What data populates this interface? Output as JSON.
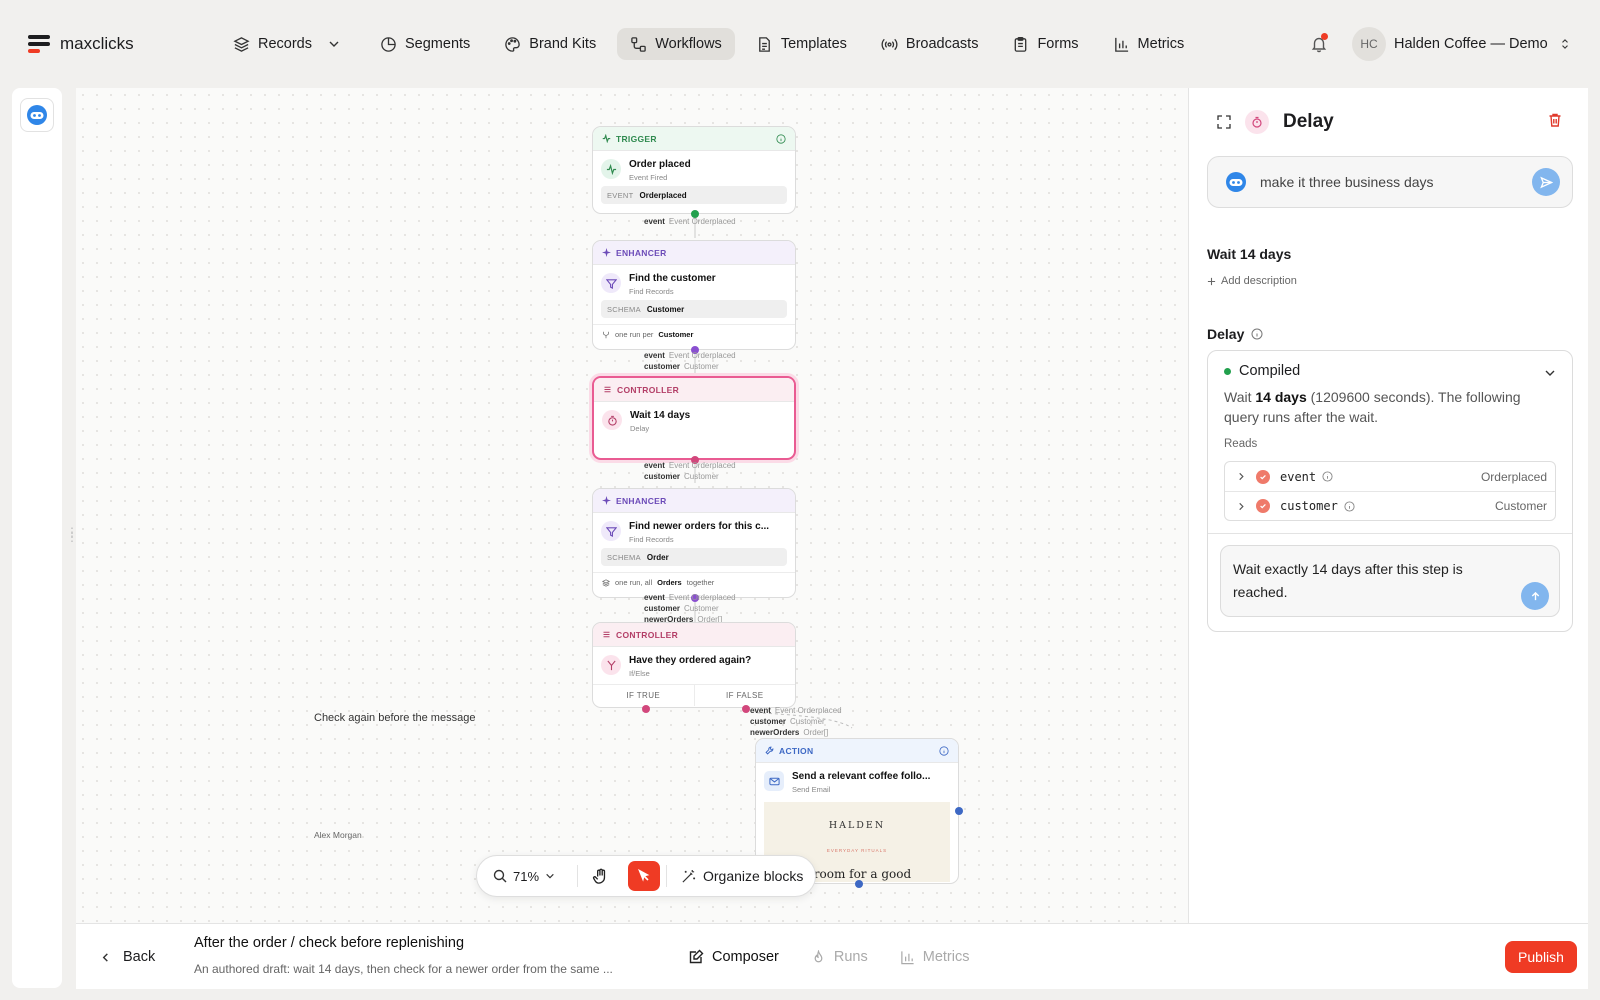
{
  "app": {
    "name": "maxclicks"
  },
  "nav": [
    {
      "label": "Records",
      "icon": "layers-icon",
      "has_dropdown": true
    },
    {
      "label": "Segments",
      "icon": "pie-icon"
    },
    {
      "label": "Brand Kits",
      "icon": "palette-icon"
    },
    {
      "label": "Workflows",
      "icon": "workflow-icon",
      "active": true
    },
    {
      "label": "Templates",
      "icon": "document-icon"
    },
    {
      "label": "Broadcasts",
      "icon": "broadcast-icon"
    },
    {
      "label": "Forms",
      "icon": "clipboard-icon"
    },
    {
      "label": "Metrics",
      "icon": "bar-chart-icon"
    }
  ],
  "account": {
    "initials": "HC",
    "name": "Halden Coffee — Demo",
    "has_notification": true
  },
  "canvas": {
    "nodes": {
      "trigger": {
        "kind": "TRIGGER",
        "title": "Order placed",
        "subtitle": "Event Fired",
        "pill_key": "EVENT",
        "pill_value": "Orderplaced"
      },
      "find_customer": {
        "kind": "ENHANCER",
        "title": "Find the customer",
        "subtitle": "Find Records",
        "pill_key": "SCHEMA",
        "pill_value": "Customer",
        "foot_prefix": "one run per",
        "foot_value": "Customer"
      },
      "wait": {
        "kind": "CONTROLLER",
        "title": "Wait 14 days",
        "subtitle": "Delay"
      },
      "find_orders": {
        "kind": "ENHANCER",
        "title": "Find newer orders for this c...",
        "subtitle": "Find Records",
        "pill_key": "SCHEMA",
        "pill_value": "Order",
        "foot_prefix": "one run, all",
        "foot_value": "Orders",
        "foot_suffix": "together"
      },
      "if_else": {
        "kind": "CONTROLLER",
        "title": "Have they ordered again?",
        "subtitle": "If/Else",
        "branch_true": "IF TRUE",
        "branch_false": "IF FALSE"
      },
      "action": {
        "kind": "ACTION",
        "title": "Send a relevant coffee follo...",
        "subtitle": "Send Email",
        "preview_brand": "HALDEN",
        "preview_tag": "EVERYDAY RITUALS",
        "preview_copy": "e room for a good"
      }
    },
    "io": {
      "after_trigger": [
        {
          "k": "event",
          "v": "Event Orderplaced"
        }
      ],
      "after_customer": [
        {
          "k": "event",
          "v": "Event Orderplaced"
        },
        {
          "k": "customer",
          "v": "Customer"
        }
      ],
      "after_wait": [
        {
          "k": "event",
          "v": "Event Orderplaced"
        },
        {
          "k": "customer",
          "v": "Customer"
        }
      ],
      "after_orders": [
        {
          "k": "event",
          "v": "Event Orderplaced"
        },
        {
          "k": "customer",
          "v": "Customer"
        },
        {
          "k": "newerOrders",
          "v": "Order[]"
        }
      ],
      "after_false": [
        {
          "k": "event",
          "v": "Event Orderplaced"
        },
        {
          "k": "customer",
          "v": "Customer"
        },
        {
          "k": "newerOrders",
          "v": "Order[]"
        }
      ]
    },
    "notes": {
      "check_again": "Check again before the message",
      "author": "Alex Morgan"
    }
  },
  "toolbar": {
    "zoom": "71%",
    "organize_label": "Organize blocks"
  },
  "inspector": {
    "title": "Delay",
    "chat_value": "make it three business days",
    "step_name": "Wait 14 days",
    "add_description": "Add description",
    "section_label": "Delay",
    "status": "Compiled",
    "summary_prefix": "Wait",
    "summary_bold": "14 days",
    "summary_rest": "(1209600 seconds). The following query runs after the wait.",
    "reads_label": "Reads",
    "reads": [
      {
        "name": "event",
        "type": "Orderplaced"
      },
      {
        "name": "customer",
        "type": "Customer"
      }
    ],
    "prompt": "Wait exactly 14 days after this step is reached."
  },
  "bottom": {
    "back_label": "Back",
    "workflow_title": "After the order / check before replenishing",
    "workflow_desc": "An authored draft: wait 14 days, then check for a newer order from the same ...",
    "tabs": [
      {
        "label": "Composer",
        "active": true
      },
      {
        "label": "Runs"
      },
      {
        "label": "Metrics"
      }
    ],
    "publish_label": "Publish"
  },
  "colors": {
    "accent": "#ef3b24",
    "selected_node": "#e95b92",
    "compiled": "#22a04d",
    "send": "#82b6ee"
  }
}
